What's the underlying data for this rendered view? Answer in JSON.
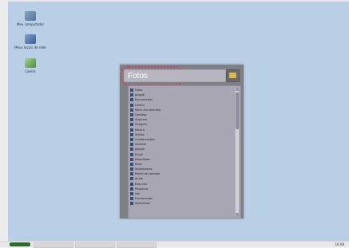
{
  "desktop": {
    "icons": [
      {
        "label": "Meu computador",
        "icon": "computer-icon"
      },
      {
        "label": "Meus locais de rede",
        "icon": "network-icon"
      },
      {
        "label": "Lixeira",
        "icon": "recycle-bin-icon"
      }
    ]
  },
  "launcher": {
    "search_value": "Fotos",
    "results": [
      {
        "text": "Fotos",
        "icon": "folder-icon"
      },
      {
        "text": "google",
        "icon": "folder-icon"
      },
      {
        "text": "Documentos",
        "icon": "document-icon"
      },
      {
        "text": "Lixeira",
        "icon": "recycle-bin-icon"
      },
      {
        "text": "Meus documentos",
        "icon": "document-icon"
      },
      {
        "text": "Desktop",
        "icon": "desktop-icon"
      },
      {
        "text": "Arquivos",
        "icon": "folder-icon"
      },
      {
        "text": "Imagens",
        "icon": "image-icon"
      },
      {
        "text": "Música",
        "icon": "music-icon"
      },
      {
        "text": "Vídeos",
        "icon": "video-icon"
      },
      {
        "text": "Configurações",
        "icon": "gear-icon"
      },
      {
        "text": "Internet",
        "icon": "globe-icon"
      },
      {
        "text": "google",
        "icon": "globe-icon"
      },
      {
        "text": "Email",
        "icon": "mail-icon"
      },
      {
        "text": "Downloads",
        "icon": "download-icon"
      },
      {
        "text": "Rede",
        "icon": "network-icon"
      },
      {
        "text": "Impressoras",
        "icon": "printer-icon"
      },
      {
        "text": "Painel de controle",
        "icon": "control-panel-icon"
      },
      {
        "text": "Ajuda",
        "icon": "help-icon"
      },
      {
        "text": "Executar",
        "icon": "run-icon"
      },
      {
        "text": "Pesquisar",
        "icon": "search-icon"
      },
      {
        "text": "Sair",
        "icon": "exit-icon"
      },
      {
        "text": "Ferramentas",
        "icon": "tools-icon"
      },
      {
        "text": "Aplicativos",
        "icon": "apps-icon"
      }
    ]
  },
  "taskbar": {
    "clock": "16:08"
  },
  "colors": {
    "desktop_bg": "#b9cfe6",
    "launcher_bg": "#7f8085",
    "highlight": "#d93a5c"
  }
}
